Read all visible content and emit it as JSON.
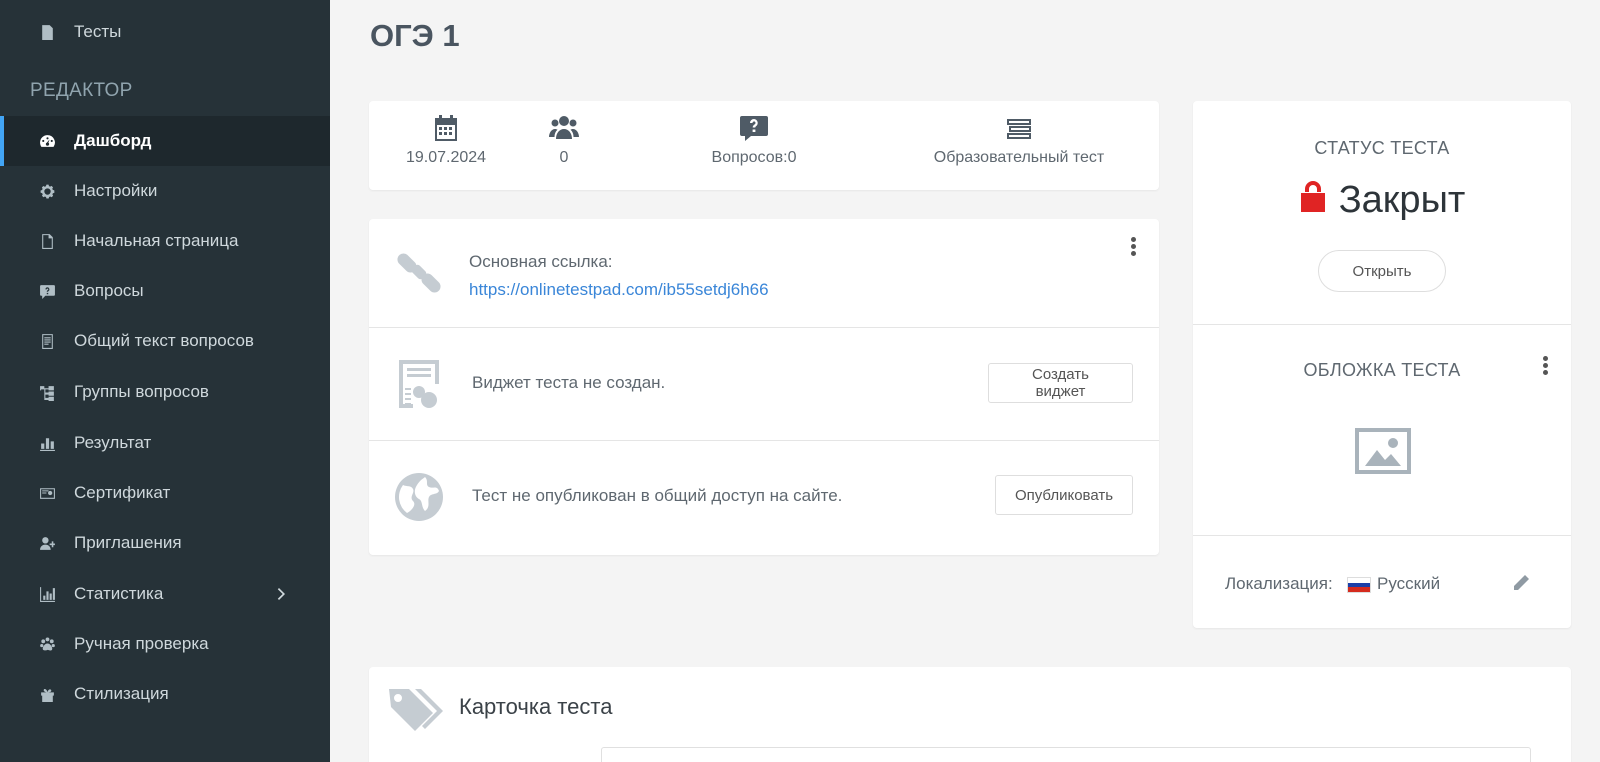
{
  "sidebar": {
    "top_item": {
      "label": "Тесты",
      "icon": "document-icon"
    },
    "section_header": "РЕДАКТОР",
    "items": [
      {
        "label": "Дашборд",
        "icon": "dashboard-icon",
        "active": true
      },
      {
        "label": "Настройки",
        "icon": "gear-icon"
      },
      {
        "label": "Начальная страница",
        "icon": "file-icon"
      },
      {
        "label": "Вопросы",
        "icon": "question-bubble-icon"
      },
      {
        "label": "Общий текст вопросов",
        "icon": "text-list-icon"
      },
      {
        "label": "Группы вопросов",
        "icon": "hierarchy-icon"
      },
      {
        "label": "Результат",
        "icon": "bar-chart-icon"
      },
      {
        "label": "Сертификат",
        "icon": "certificate-icon"
      },
      {
        "label": "Приглашения",
        "icon": "user-plus-icon"
      },
      {
        "label": "Статистика",
        "icon": "chart-icon",
        "has_submenu": true
      },
      {
        "label": "Ручная проверка",
        "icon": "paw-icon"
      },
      {
        "label": "Стилизация",
        "icon": "gift-icon"
      }
    ],
    "accent_color": "#42a5f5"
  },
  "main": {
    "title": "ОГЭ 1",
    "stats": {
      "date": "19.07.2024",
      "participants": "0",
      "questions": "Вопросов:0",
      "type": "Образовательный тест"
    },
    "links": {
      "main_link_label": "Основная ссылка:",
      "main_link_url": "https://onlinetestpad.com/ib55setdj6h66",
      "widget_text": "Виджет теста не создан.",
      "widget_button": "Создать виджет",
      "publish_text": "Тест не опубликован в общий доступ на сайте.",
      "publish_button": "Опубликовать"
    },
    "status": {
      "title": "СТАТУС ТЕСТА",
      "value": "Закрыт",
      "open_button": "Открыть",
      "cover_title": "ОБЛОЖКА ТЕСТА",
      "locale_label": "Локализация:",
      "locale_value": "Русский",
      "lock_color": "#e02424"
    },
    "card": {
      "title": "Карточка теста"
    }
  }
}
